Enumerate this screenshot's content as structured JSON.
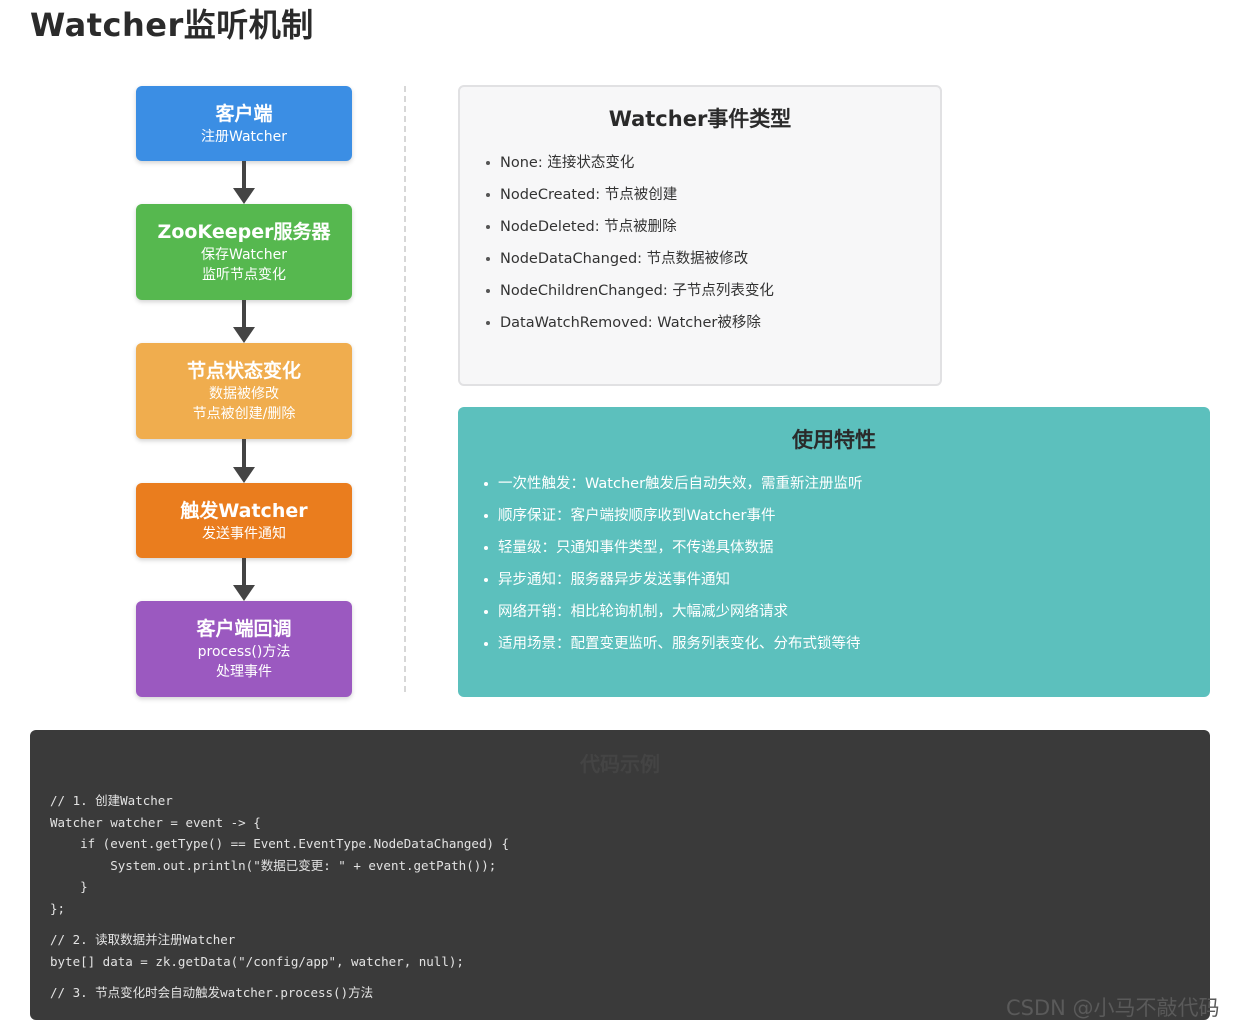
{
  "title": "Watcher监听机制",
  "flow": [
    {
      "title": "客户端",
      "lines": [
        "注册Watcher"
      ],
      "color": "#3b8ee4"
    },
    {
      "title": "ZooKeeper服务器",
      "lines": [
        "保存Watcher",
        "监听节点变化"
      ],
      "color": "#56b84f"
    },
    {
      "title": "节点状态变化",
      "lines": [
        "数据被修改",
        "节点被创建/删除"
      ],
      "color": "#f0ad4e"
    },
    {
      "title": "触发Watcher",
      "lines": [
        "发送事件通知"
      ],
      "color": "#ea7d1e"
    },
    {
      "title": "客户端回调",
      "lines": [
        "process()方法",
        "处理事件"
      ],
      "color": "#9b59c0"
    }
  ],
  "events_panel": {
    "title": "Watcher事件类型",
    "items": [
      "None: 连接状态变化",
      "NodeCreated: 节点被创建",
      "NodeDeleted: 节点被删除",
      "NodeDataChanged: 节点数据被修改",
      "NodeChildrenChanged: 子节点列表变化",
      "DataWatchRemoved: Watcher被移除"
    ]
  },
  "features_panel": {
    "title": "使用特性",
    "items": [
      "一次性触发：Watcher触发后自动失效，需重新注册监听",
      "顺序保证：客户端按顺序收到Watcher事件",
      "轻量级：只通知事件类型，不传递具体数据",
      "异步通知：服务器异步发送事件通知",
      "网络开销：相比轮询机制，大幅减少网络请求",
      "适用场景：配置变更监听、服务列表变化、分布式锁等待"
    ]
  },
  "code": {
    "title": "代码示例",
    "lines": [
      "// 1. 创建Watcher",
      "Watcher watcher = event -> {",
      "    if (event.getType() == Event.EventType.NodeDataChanged) {",
      "        System.out.println(\"数据已变更: \" + event.getPath());",
      "    }",
      "};",
      "// 2. 读取数据并注册Watcher",
      "byte[] data = zk.getData(\"/config/app\", watcher, null);",
      "// 3. 节点变化时会自动触发watcher.process()方法"
    ]
  },
  "watermark": "CSDN @小马不敲代码"
}
